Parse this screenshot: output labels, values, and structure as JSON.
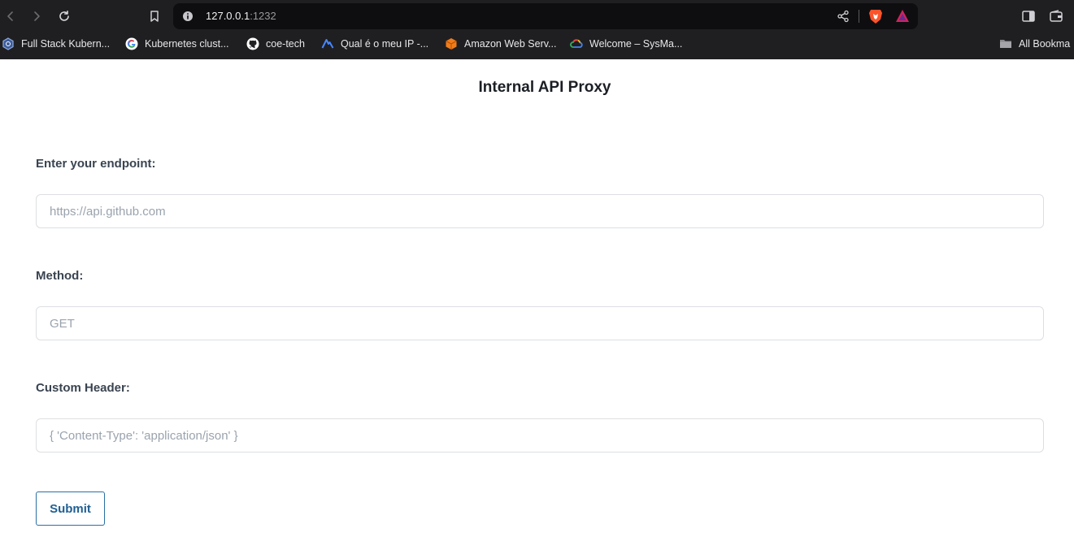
{
  "browser": {
    "url_host": "127.0.0.1",
    "url_port": ":1232",
    "bookmarks": [
      {
        "label": "Full Stack Kubern...",
        "icon": "kubernetes-icon"
      },
      {
        "label": "Kubernetes clust...",
        "icon": "google-icon"
      },
      {
        "label": "coe-tech",
        "icon": "github-icon"
      },
      {
        "label": "Qual é o meu IP -...",
        "icon": "nordvpn-icon"
      },
      {
        "label": "Amazon Web Serv...",
        "icon": "aws-icon"
      },
      {
        "label": "Welcome – SysMa...",
        "icon": "google-cloud-icon"
      }
    ],
    "all_bookmarks_label": "All Bookma"
  },
  "page": {
    "title": "Internal API Proxy",
    "endpoint": {
      "label": "Enter your endpoint:",
      "placeholder": "https://api.github.com",
      "value": ""
    },
    "method": {
      "label": "Method:",
      "placeholder": "GET",
      "value": ""
    },
    "header": {
      "label": "Custom Header:",
      "placeholder": "{ 'Content-Type': 'application/json' }",
      "value": ""
    },
    "submit_label": "Submit"
  },
  "colors": {
    "chrome_bg": "#1f1f22",
    "omnibox_bg": "#0e0e10",
    "accent": "#1f5f92",
    "label": "#3a4450",
    "placeholder": "#9aa3ad"
  }
}
